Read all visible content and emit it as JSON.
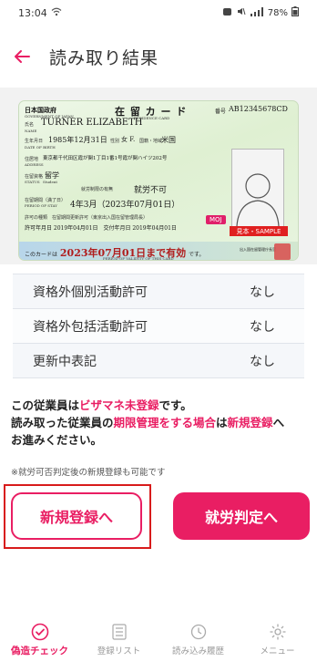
{
  "status_bar": {
    "time": "13:04",
    "battery": "78%"
  },
  "header": {
    "title": "読み取り結果"
  },
  "card": {
    "gov_jp": "日本国政府",
    "gov_en": "GOVERNMENT OF JAPAN",
    "card_title": "在 留 カ ー ド",
    "card_title_en": "RESIDENCE CARD",
    "number_label": "番号",
    "number": "AB12345678CD",
    "name_label": "氏名",
    "name_label_en": "NAME",
    "name": "TURNER ELIZABETH",
    "dob_label": "生年月日",
    "dob_label_en": "DATE OF BIRTH",
    "dob": "1985年12月31日",
    "sex_label": "性別",
    "sex": "女 F.",
    "nationality_label": "国籍・地域",
    "nationality": "米国",
    "address_label": "住居地",
    "address_label_en": "ADDRESS",
    "address": "東京都千代田区霞が関1丁目1番1号霞が関ハイツ202号",
    "status_label": "在留資格",
    "status_label_en": "STATUS",
    "status": "留学",
    "status_en": "Student",
    "work_label": "就労制限の有無",
    "work": "就労不可",
    "period_label": "在留期間（満了日）",
    "period_label_en": "PERIOD OF STAY",
    "period": "4年3月（2023年07月01日）",
    "permit_label": "許可の種類",
    "permit": "在留期間更新許可（東京出入国在留管理局長）",
    "permit_date": "許可年月日 2019年04月01日　交付年月日 2019年04月01日",
    "moj": "MOJ",
    "sample": "見本・SAMPLE",
    "validity_prefix": "このカードは",
    "validity": "2023年07月01日まで有効",
    "validity_suffix": "です。",
    "validity_en": "PERIOD OF VALIDITY OF THIS CARD",
    "issuer": "出入国在留管理庁長官"
  },
  "permissions": [
    {
      "label": "資格外個別活動許可",
      "value": "なし"
    },
    {
      "label": "資格外包括活動許可",
      "value": "なし"
    },
    {
      "label": "更新中表記",
      "value": "なし"
    }
  ],
  "message": {
    "line1_a": "この従業員は",
    "line1_b": "ビザマネ未登録",
    "line1_c": "です。",
    "line2_a": "読み取った従業員の",
    "line2_b": "期限管理をする場合",
    "line2_c": "は",
    "line2_d": "新規登録",
    "line2_e": "へ",
    "line3": "お進みください。"
  },
  "note": "※就労可否判定後の新規登録も可能です",
  "buttons": {
    "register": "新規登録へ",
    "judge": "就労判定へ"
  },
  "nav": [
    {
      "label": "偽造チェック",
      "icon": "check-circle-icon",
      "active": true
    },
    {
      "label": "登録リスト",
      "icon": "list-icon",
      "active": false
    },
    {
      "label": "読み込み履歴",
      "icon": "history-icon",
      "active": false
    },
    {
      "label": "メニュー",
      "icon": "gear-icon",
      "active": false
    }
  ],
  "colors": {
    "accent": "#e91e63",
    "highlight": "#d81b1b"
  }
}
